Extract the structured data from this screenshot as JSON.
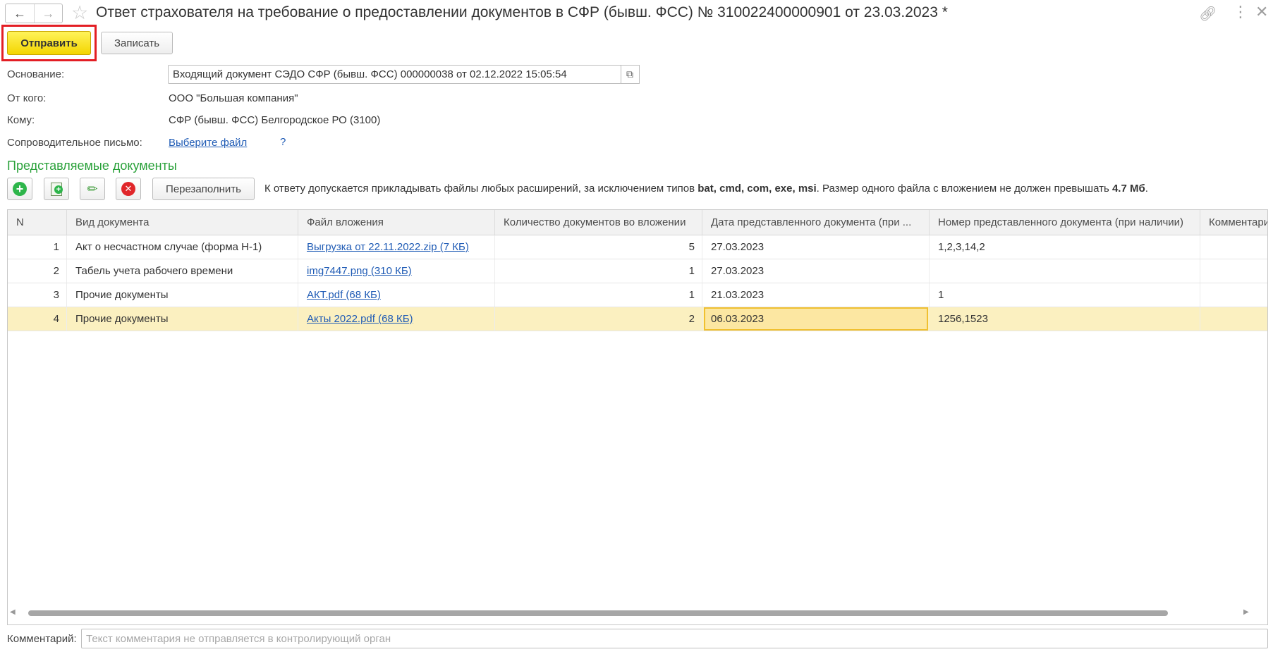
{
  "window": {
    "title": "Ответ страхователя на требование о предоставлении документов в СФР (бывш. ФСС) № 310022400000901 от 23.03.2023 *",
    "back_icon": "arrow-left-icon",
    "forward_icon": "arrow-right-icon",
    "favorite_icon": "star-icon",
    "link_icon": "link-icon",
    "more_icon": "more-vertical-icon",
    "close_icon": "close-icon"
  },
  "toolbar": {
    "send_label": "Отправить",
    "write_label": "Записать",
    "highlight_color": "#e31e24",
    "send_color": "#f5d800"
  },
  "form": {
    "basis": {
      "label": "Основание:",
      "value": "Входящий документ СЭДО СФР (бывш. ФСС) 000000038 от 02.12.2022 15:05:54"
    },
    "from": {
      "label": "От кого:",
      "value": "ООО \"Большая компания\""
    },
    "to": {
      "label": "Кому:",
      "value": "СФР (бывш. ФСС) Белгородское РО (3100)"
    },
    "cover_letter": {
      "label": "Сопроводительное письмо:",
      "link": "Выберите файл",
      "help": "?"
    }
  },
  "section_title": "Представляемые документы",
  "table_toolbar": {
    "add_icon": "plus-circle-icon",
    "copy_icon": "copy-add-icon",
    "edit_icon": "pencil-icon",
    "delete_icon": "delete-circle-icon",
    "refill_label": "Перезаполнить",
    "hint_prefix": "К ответу допускается прикладывать файлы любых расширений, за исключением типов",
    "hint_types": "bat, cmd, com, exe, msi",
    "hint_middle": ". Размер одного файла с вложением не должен превышать",
    "hint_size": "4.7 Мб",
    "hint_suffix": "."
  },
  "table": {
    "columns": [
      "N",
      "Вид документа",
      "Файл вложения",
      "Количество документов во вложении",
      "Дата представленного документа (при ...",
      "Номер представленного документа (при наличии)",
      "Комментарий"
    ],
    "rows": [
      {
        "n": "1",
        "type": "Акт о несчастном случае (форма Н-1)",
        "file": "Выгрузка от 22.11.2022.zip (7 КБ)",
        "count": "5",
        "date": "27.03.2023",
        "number": "1,2,3,14,2",
        "comment": ""
      },
      {
        "n": "2",
        "type": "Табель учета рабочего времени",
        "file": "img7447.png (310 КБ)",
        "count": "1",
        "date": "27.03.2023",
        "number": "",
        "comment": ""
      },
      {
        "n": "3",
        "type": "Прочие документы",
        "file": "АКТ.pdf (68 КБ)",
        "count": "1",
        "date": "21.03.2023",
        "number": "1",
        "comment": ""
      },
      {
        "n": "4",
        "type": "Прочие документы",
        "file": "Акты 2022.pdf (68 КБ)",
        "count": "2",
        "date": "06.03.2023",
        "number": "1256,1523",
        "comment": ""
      }
    ],
    "selected_row": 4,
    "selected_color": "#fbf0c0"
  },
  "comment": {
    "label": "Комментарий:",
    "placeholder": "Текст комментария не отправляется в контролирующий орган",
    "value": ""
  }
}
